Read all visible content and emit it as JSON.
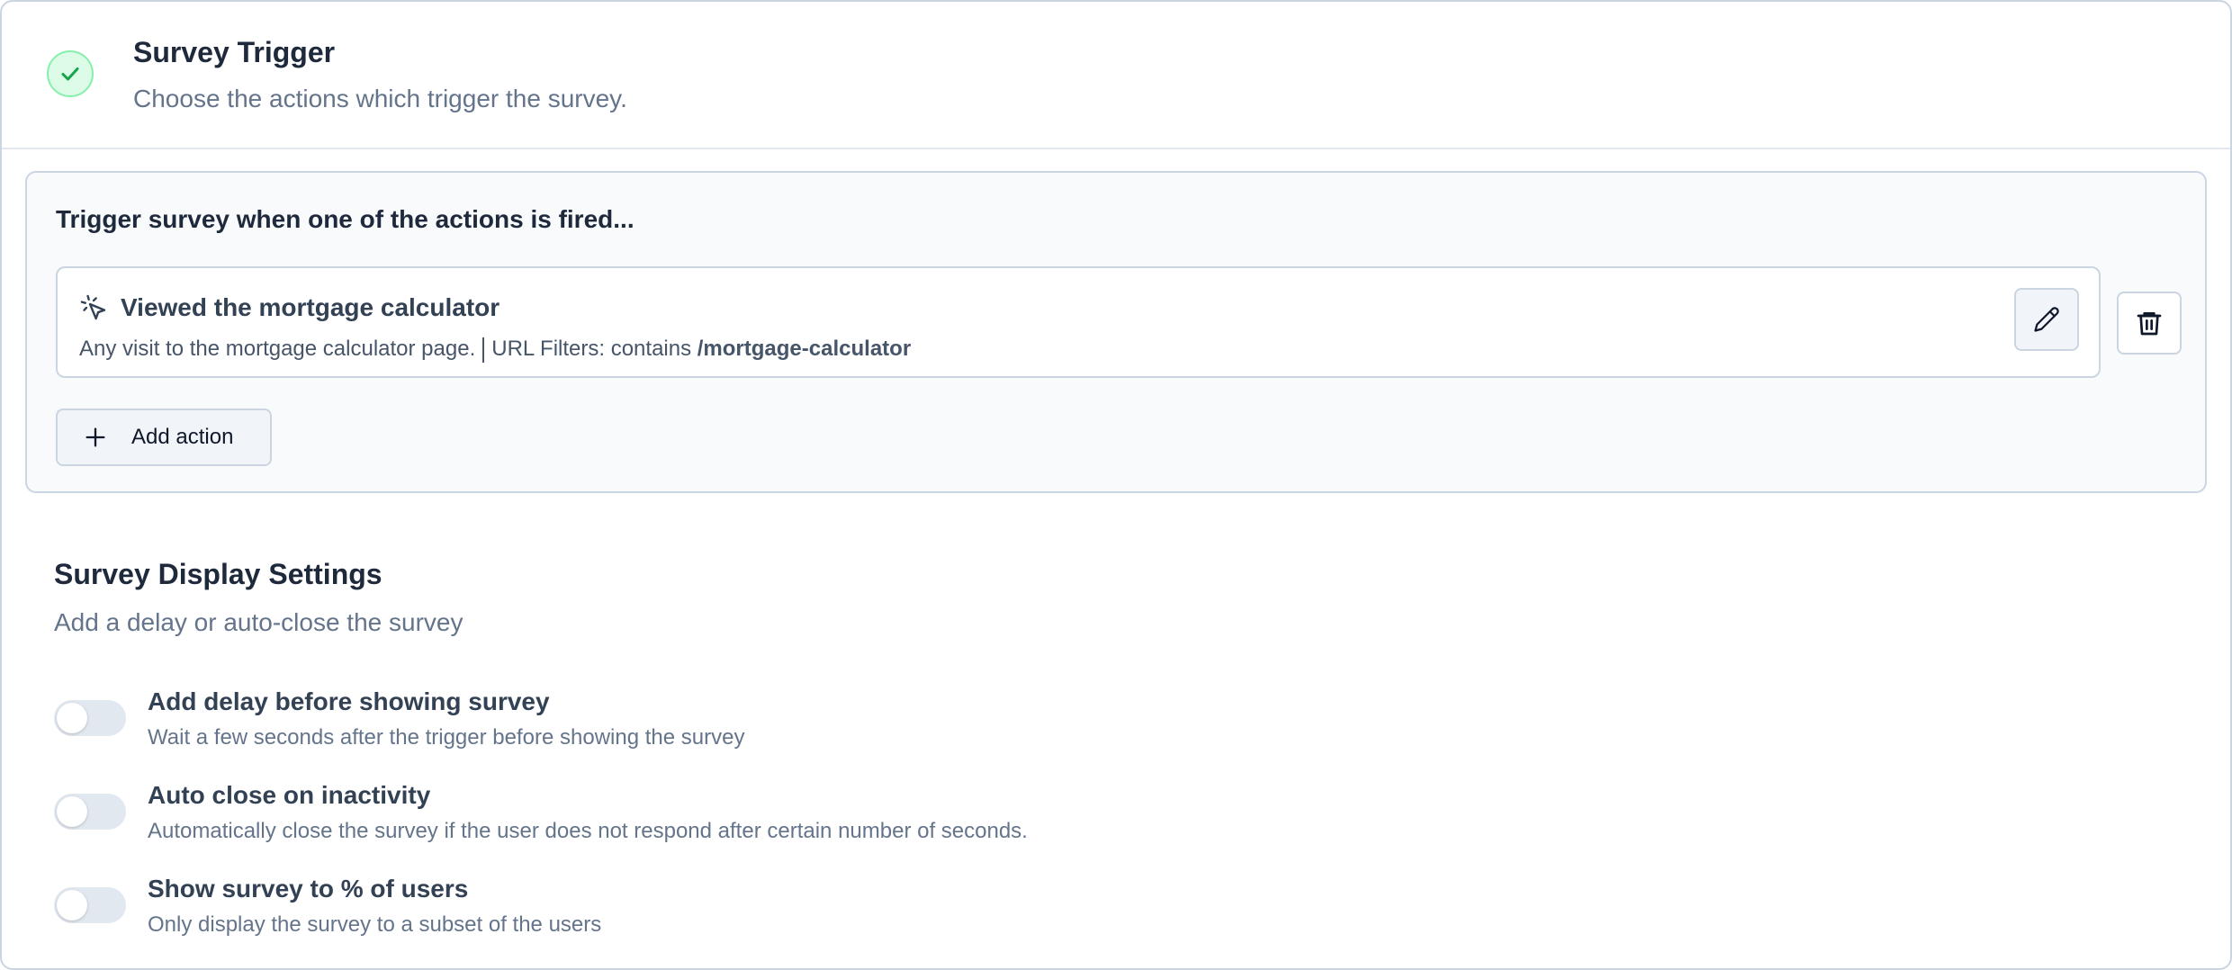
{
  "trigger": {
    "title": "Survey Trigger",
    "subtitle": "Choose the actions which trigger the survey."
  },
  "actions_panel": {
    "title": "Trigger survey when one of the actions is fired...",
    "items": [
      {
        "name": "Viewed the mortgage calculator",
        "description": "Any visit to the mortgage calculator page.",
        "filter_prefix": "URL Filters: contains ",
        "filter_value": "/mortgage-calculator"
      }
    ],
    "add_label": "Add action"
  },
  "display": {
    "title": "Survey Display Settings",
    "subtitle": "Add a delay or auto-close the survey",
    "settings": [
      {
        "label": "Add delay before showing survey",
        "description": "Wait a few seconds after the trigger before showing the survey",
        "enabled": false
      },
      {
        "label": "Auto close on inactivity",
        "description": "Automatically close the survey if the user does not respond after certain number of seconds.",
        "enabled": false
      },
      {
        "label": "Show survey to % of users",
        "description": "Only display the survey to a subset of the users",
        "enabled": false
      }
    ]
  },
  "colors": {
    "check_bg": "#dcfce7",
    "check_icon": "#16a34a",
    "border": "#cbd5e1"
  }
}
